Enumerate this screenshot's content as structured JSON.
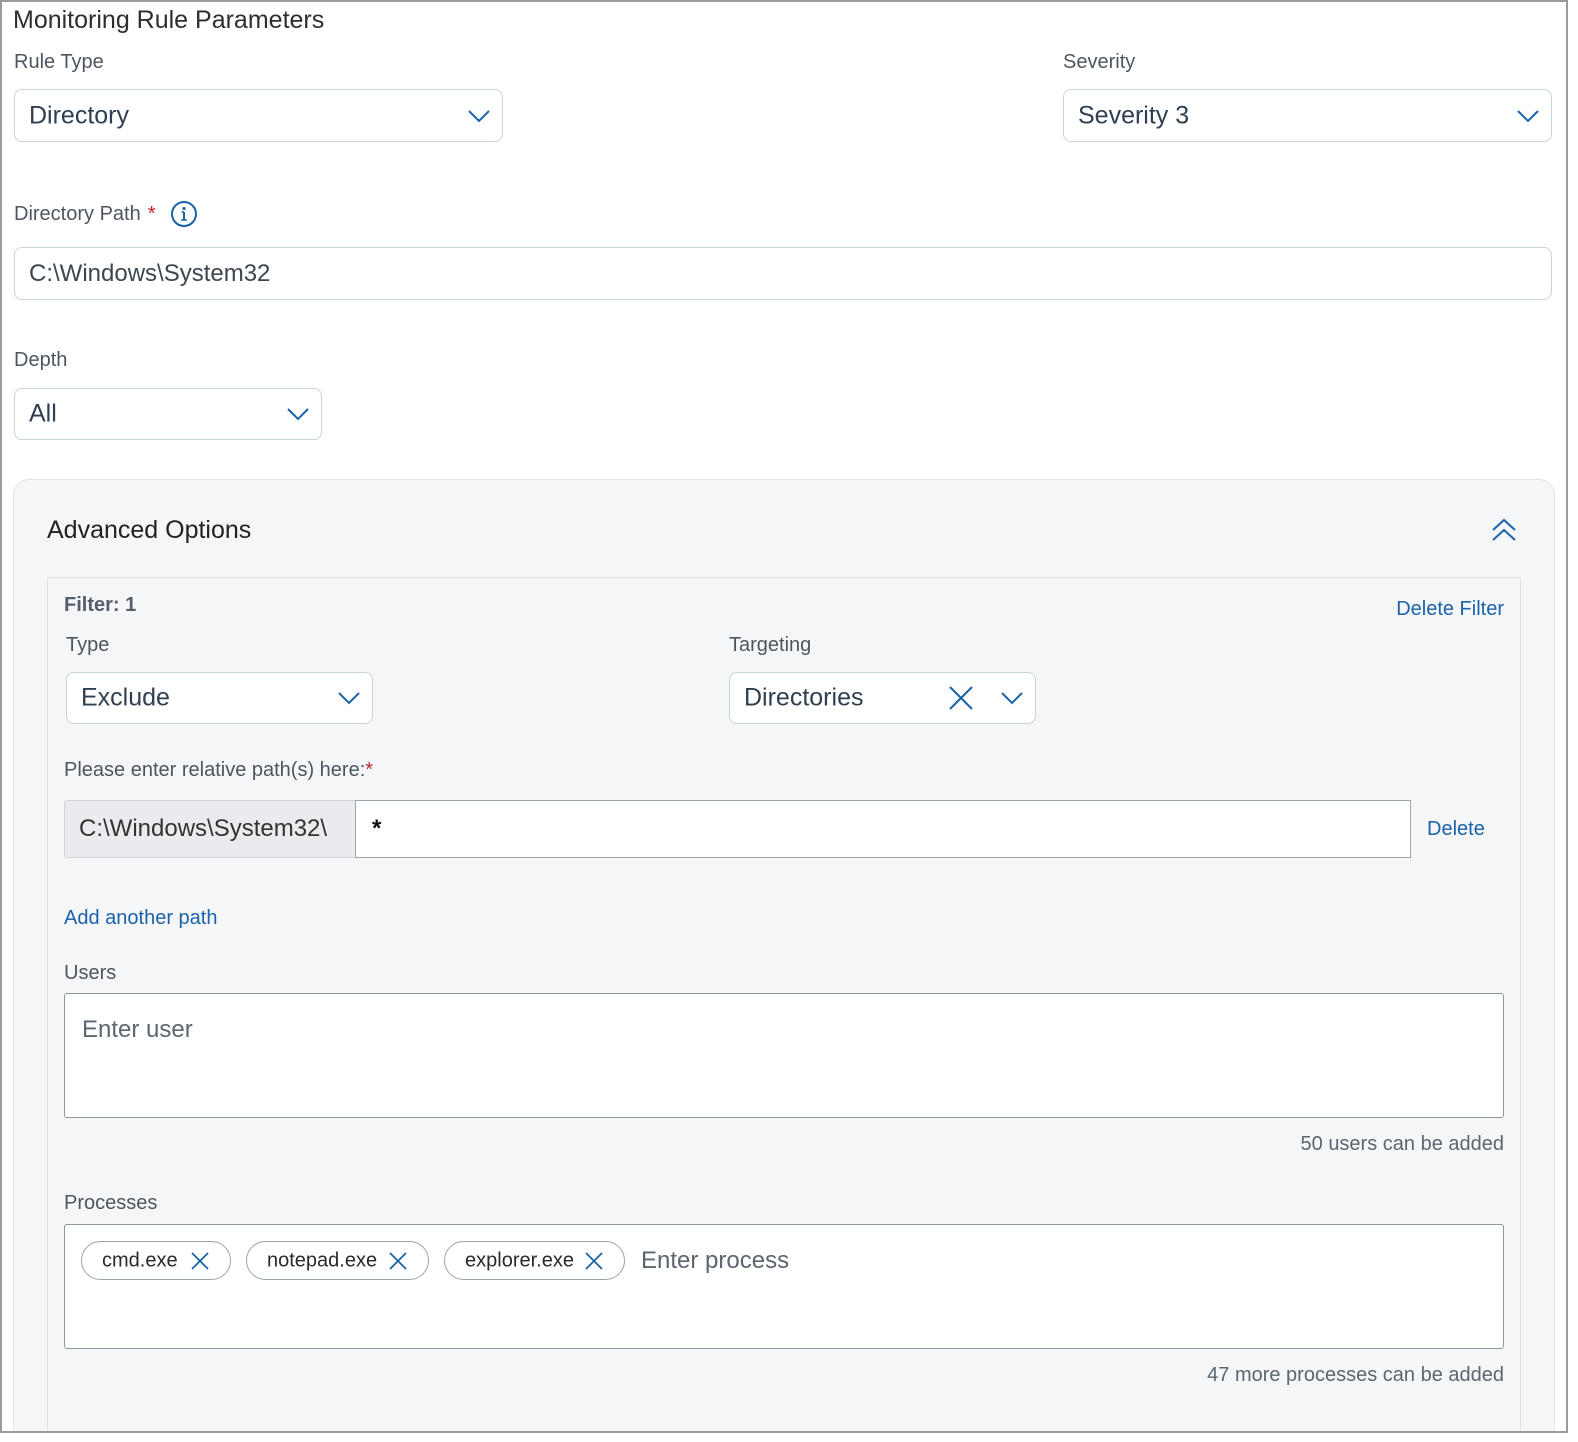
{
  "page_title": "Monitoring Rule Parameters",
  "rule_type": {
    "label": "Rule Type",
    "value": "Directory"
  },
  "severity": {
    "label": "Severity",
    "value": "Severity 3"
  },
  "directory_path": {
    "label": "Directory Path",
    "required_mark": "*",
    "value": "C:\\Windows\\System32"
  },
  "depth": {
    "label": "Depth",
    "value": "All"
  },
  "advanced": {
    "title": "Advanced Options",
    "filter": {
      "title": "Filter: 1",
      "delete_filter": "Delete Filter",
      "type": {
        "label": "Type",
        "value": "Exclude"
      },
      "targeting": {
        "label": "Targeting",
        "value": "Directories"
      },
      "paths": {
        "label": "Please enter relative path(s) here:",
        "required_mark": "*",
        "prefix": "C:\\Windows\\System32\\",
        "value": "*",
        "delete": "Delete",
        "add_another": "Add another path"
      },
      "users": {
        "label": "Users",
        "placeholder": "Enter user",
        "count": "50",
        "count_text": "users can be added"
      },
      "processes": {
        "label": "Processes",
        "chips": [
          "cmd.exe",
          "notepad.exe",
          "explorer.exe"
        ],
        "placeholder": "Enter process",
        "count": "47",
        "count_text": "more processes can be added"
      }
    }
  },
  "colors": {
    "accent": "#1b62a8",
    "required": "#c0262d",
    "border": "#c7d3df"
  },
  "icons": {
    "chevron": "chevron-down-icon",
    "collapse": "chevron-double-up-icon",
    "info": "info-icon",
    "clear": "close-icon"
  }
}
